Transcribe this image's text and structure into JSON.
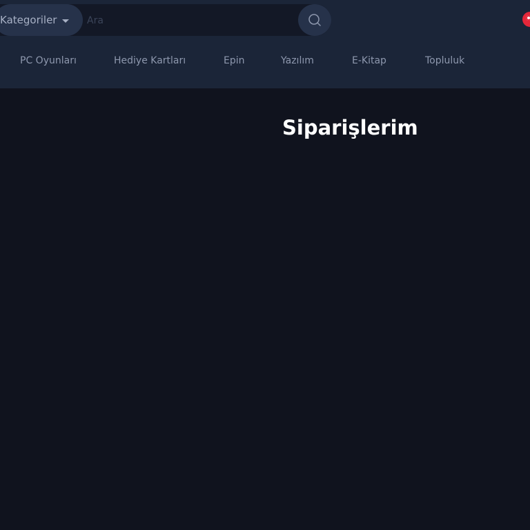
{
  "header": {
    "categories_label": "Kategoriler",
    "search_placeholder": "Ara",
    "icons": {
      "caret": "caret-down-icon",
      "search": "search-icon",
      "logo": "brand-logo-icon"
    }
  },
  "nav": {
    "items": [
      {
        "label": "PC Oyunları"
      },
      {
        "label": "Hediye Kartları"
      },
      {
        "label": "Epin"
      },
      {
        "label": "Yazılım"
      },
      {
        "label": "E-Kitap"
      },
      {
        "label": "Topluluk"
      }
    ]
  },
  "main": {
    "title": "Siparişlerim"
  },
  "colors": {
    "page_bg": "#10131e",
    "header_bg": "#1b2538",
    "accent_red": "#e4273a",
    "nav_text": "#8e98ae"
  }
}
